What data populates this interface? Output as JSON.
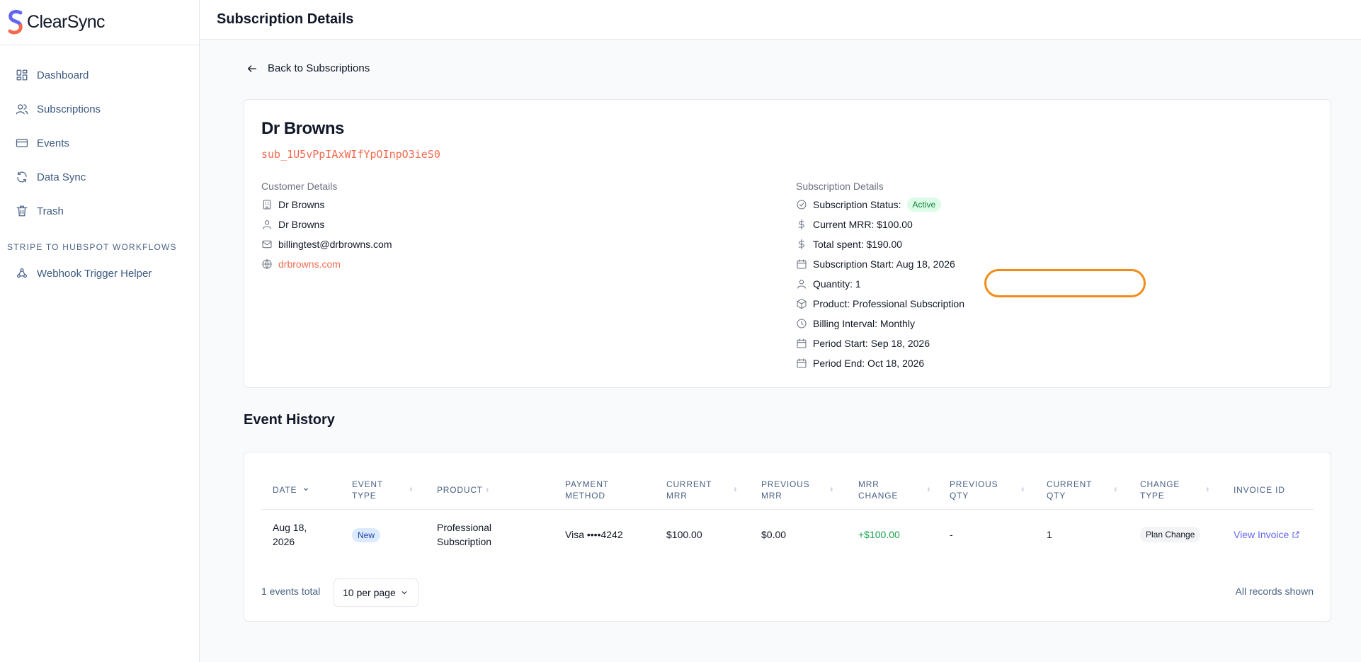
{
  "app": {
    "name": "ClearSync"
  },
  "sidebar": {
    "items": [
      {
        "label": "Dashboard",
        "icon": "dashboard-icon"
      },
      {
        "label": "Subscriptions",
        "icon": "users-icon"
      },
      {
        "label": "Events",
        "icon": "card-icon"
      },
      {
        "label": "Data Sync",
        "icon": "refresh-icon"
      },
      {
        "label": "Trash",
        "icon": "trash-icon"
      }
    ],
    "section_title": "STRIPE TO HUBSPOT WORKFLOWS",
    "section_items": [
      {
        "label": "Webhook Trigger Helper",
        "icon": "webhook-icon"
      }
    ]
  },
  "header": {
    "title": "Subscription Details"
  },
  "back_label": "Back to Subscriptions",
  "subscription": {
    "customer_name": "Dr Browns",
    "id": "sub_1U5vPpIAxWIfYpOInpO3ieS0"
  },
  "customer_details": {
    "title": "Customer Details",
    "company": "Dr Browns",
    "contact": "Dr Browns",
    "email": "billingtest@drbrowns.com",
    "website": "drbrowns.com"
  },
  "subscription_details": {
    "title": "Subscription Details",
    "status_label": "Subscription Status:",
    "status_value": "Active",
    "current_mrr": "Current MRR: $100.00",
    "total_spent": "Total spent: $190.00",
    "start": "Subscription Start: Aug 18, 2026",
    "quantity": "Quantity: 1",
    "product": "Product: Professional Subscription",
    "interval": "Billing Interval: Monthly",
    "period_start": "Period Start: Sep 18, 2026",
    "period_end": "Period End: Oct 18, 2026"
  },
  "event_history": {
    "title": "Event History",
    "columns": {
      "date": "DATE",
      "event_type_1": "EVENT",
      "event_type_2": "TYPE",
      "product": "PRODUCT",
      "payment_1": "PAYMENT",
      "payment_2": "METHOD",
      "current_mrr_1": "CURRENT",
      "current_mrr_2": "MRR",
      "previous_mrr_1": "PREVIOUS",
      "previous_mrr_2": "MRR",
      "mrr_change_1": "MRR",
      "mrr_change_2": "CHANGE",
      "previous_qty_1": "PREVIOUS",
      "previous_qty_2": "QTY",
      "current_qty_1": "CURRENT",
      "current_qty_2": "QTY",
      "change_type_1": "CHANGE",
      "change_type_2": "TYPE",
      "invoice_id": "INVOICE ID"
    },
    "rows": [
      {
        "date_1": "Aug 18,",
        "date_2": "2026",
        "event_type": "New",
        "product_1": "Professional",
        "product_2": "Subscription",
        "payment_method": "Visa ••••4242",
        "current_mrr": "$100.00",
        "previous_mrr": "$0.00",
        "mrr_change": "+$100.00",
        "previous_qty": "-",
        "current_qty": "1",
        "change_type": "Plan Change",
        "invoice": "View Invoice"
      }
    ],
    "total_label": "1 events total",
    "per_page": "10 per page",
    "shown_label": "All records shown"
  },
  "colors": {
    "accent": "#f26b4f",
    "highlight": "#f28c18",
    "positive": "#16a34a",
    "link": "#6366f1"
  }
}
